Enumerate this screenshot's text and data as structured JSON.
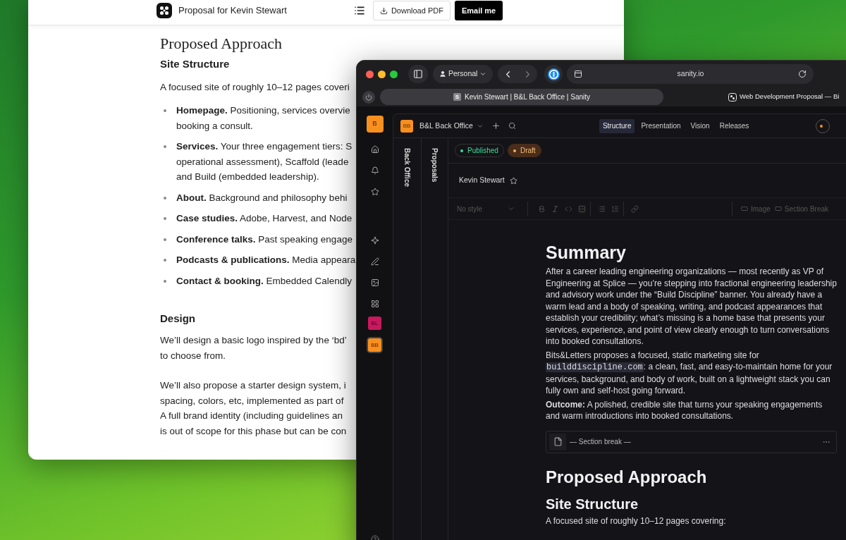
{
  "back_window": {
    "header": {
      "title": "Proposal for Kevin Stewart",
      "download_button": "Download PDF",
      "email_button": "Email me"
    },
    "heading": "Proposed Approach",
    "subheading": "Site Structure",
    "intro": "A focused site of roughly 10–12 pages coveri",
    "bullets": [
      {
        "lines": [
          "**Homepage.** Positioning, services overvie",
          "booking a consult."
        ]
      },
      {
        "lines": [
          "**Services.** Your three engagement tiers: S",
          "operational assessment), Scaffold (leade",
          "and Build (embedded leadership)."
        ]
      },
      {
        "lines": [
          "**About.** Background and philosophy behi"
        ]
      },
      {
        "lines": [
          "**Case studies.** Adobe, Harvest, and Node"
        ]
      },
      {
        "lines": [
          "**Conference talks.** Past speaking engage"
        ]
      },
      {
        "lines": [
          "**Podcasts & publications.** Media appeara"
        ]
      },
      {
        "lines": [
          "**Contact & booking.** Embedded Calendly"
        ]
      }
    ],
    "design_heading": "Design",
    "paragraphs": [
      {
        "lines": [
          "We’ll design a basic logo inspired by the ‘bd’",
          "to choose from."
        ]
      },
      {
        "lines": [
          "We’ll also propose a starter design system, i",
          "spacing, colors, etc, implemented as part of",
          "A full brand identity (including guidelines an",
          "is out of scope for this phase but can be con"
        ]
      }
    ]
  },
  "browser": {
    "profile": "Personal",
    "address": "sanity.io",
    "tabs": [
      {
        "title": "Kevin Stewart | B&L Back Office | Sanity",
        "favicon": "S",
        "selected": true
      },
      {
        "title": "Web Development Proposal — Bi",
        "selected": false
      }
    ]
  },
  "studio": {
    "rail": {
      "workspace": "B",
      "tools": [
        {
          "label": "BL",
          "color": "#c8195f",
          "selected": false
        },
        {
          "label": "BB",
          "color": "#f8901f",
          "selected": true
        }
      ]
    },
    "workspace": {
      "badge": "BB",
      "name": "B&L Back Office"
    },
    "nav_tabs": [
      {
        "label": "Structure",
        "selected": true
      },
      {
        "label": "Presentation",
        "selected": false
      },
      {
        "label": "Vision",
        "selected": false
      },
      {
        "label": "Releases",
        "selected": false
      }
    ],
    "panes": [
      "Back Office",
      "Proposals"
    ],
    "status_chips": [
      {
        "label": "Published",
        "kind": "published",
        "selected": false
      },
      {
        "label": "Draft",
        "kind": "draft",
        "selected": true
      }
    ],
    "document_title": "Kevin Stewart",
    "toolbar": {
      "style_select": "No style",
      "inserts": [
        "Image",
        "Section Break"
      ]
    },
    "content": [
      {
        "kind": "h1",
        "text": "Summary"
      },
      {
        "kind": "p",
        "parts": [
          {
            "text": "After a career leading engineering organizations — most recently as VP of Engineering at Splice — you’re stepping into fractional engineering leadership and advisory work under the “Build Discipline” banner. You already have a warm lead and a body of speaking, writing, and podcast appearances that establish your credibility; what’s missing is a home base that presents your services, experience, and point of view clearly enough to turn conversations into booked consultations."
          }
        ]
      },
      {
        "kind": "p",
        "parts": [
          {
            "text": "Bits&Letters proposes a focused, static marketing site for "
          },
          {
            "text": "builddiscipline.com",
            "kind": "code"
          },
          {
            "text": ": a clean, fast, and easy-to-maintain home for your services, background, and body of work, built on a lightweight stack you can fully own and self-host going forward."
          }
        ]
      },
      {
        "kind": "p",
        "parts": [
          {
            "text": "**Outcome:** A polished, credible site that turns your speaking engagements and warm introductions into booked consultations."
          }
        ]
      },
      {
        "kind": "section_break",
        "text": "— Section break —"
      },
      {
        "kind": "h1",
        "text": "Proposed Approach"
      },
      {
        "kind": "h2",
        "text": "Site Structure"
      },
      {
        "kind": "p",
        "parts": [
          {
            "text": "A focused site of roughly 10–12 pages covering:"
          }
        ]
      }
    ]
  }
}
